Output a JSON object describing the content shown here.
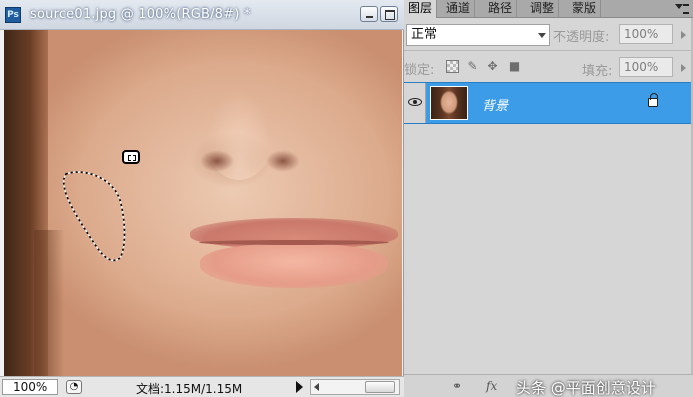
{
  "document": {
    "title": "source01.jpg @ 100%(RGB/8#) *",
    "app_logo": "Ps",
    "zoom": "100%",
    "doc_size": "文档:1.15M/1.15M"
  },
  "layers_panel": {
    "tabs": [
      "图层",
      "通道",
      "路径",
      "调整",
      "蒙版"
    ],
    "active_tab": "图层",
    "blend_mode": "正常",
    "opacity_label": "不透明度:",
    "opacity_value": "100%",
    "lock_label": "锁定:",
    "fill_label": "填充:",
    "fill_value": "100%",
    "layers": [
      {
        "name": "背景",
        "visible": true,
        "locked": true,
        "selected": true
      }
    ]
  },
  "watermark": "头条 @平面创意设计",
  "colors": {
    "layer_selected": "#3c9ce7",
    "panel_bg": "#d6d6d6"
  },
  "icons": {
    "lock_transparent": "checker-icon",
    "lock_image": "brush-icon",
    "lock_position": "move-icon",
    "lock_all": "lock-icon",
    "bottom": [
      "link-icon",
      "fx-icon"
    ]
  }
}
